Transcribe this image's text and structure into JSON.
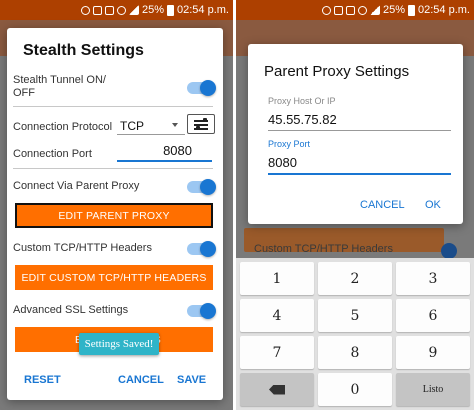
{
  "status_bar": {
    "battery": "25%",
    "time": "02:54 p.m."
  },
  "stealth_dialog": {
    "title": "Stealth Settings",
    "tunnel_label": "Stealth Tunnel ON/ OFF",
    "protocol_label": "Connection Protocol",
    "protocol_value": "TCP",
    "port_label": "Connection Port",
    "port_value": "8080",
    "parent_proxy_label": "Connect Via Parent Proxy",
    "edit_parent_proxy": "EDIT PARENT PROXY",
    "custom_headers_label": "Custom TCP/HTTP Headers",
    "edit_custom_headers": "EDIT CUSTOM TCP/HTTP HEADERS",
    "ssl_label": "Advanced SSL Settings",
    "third_button_left": "E",
    "third_button_right": "S",
    "toast": "Settings Saved!",
    "reset": "RESET",
    "cancel": "CANCEL",
    "save": "SAVE"
  },
  "proxy_dialog": {
    "title": "Parent Proxy Settings",
    "host_label": "Proxy Host Or IP",
    "host_value": "45.55.75.82",
    "port_label": "Proxy Port",
    "port_value": "8080",
    "cancel": "CANCEL",
    "ok": "OK"
  },
  "background": {
    "headers_label": "Custom TCP/HTTP Headers"
  },
  "keypad": {
    "keys": [
      "1",
      "2",
      "3",
      "4",
      "5",
      "6",
      "7",
      "8",
      "9",
      "0"
    ],
    "done": "Listo"
  }
}
